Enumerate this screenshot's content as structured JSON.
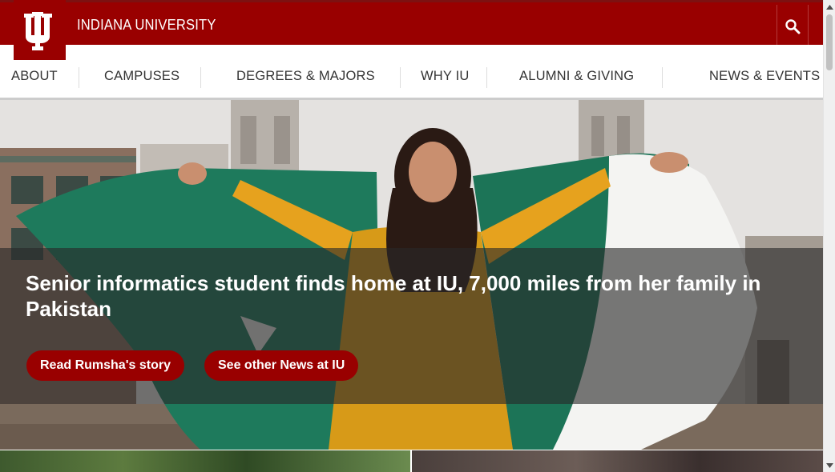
{
  "header": {
    "logo_alt": "IU",
    "title": "INDIANA UNIVERSITY",
    "search_icon": "search-icon",
    "brand_color": "#990000"
  },
  "nav": {
    "items": [
      "ABOUT",
      "CAMPUSES",
      "DEGREES & MAJORS",
      "WHY IU",
      "ALUMNI & GIVING",
      "NEWS & EVENTS"
    ]
  },
  "hero": {
    "headline": "Senior informatics student finds home at IU, 7,000 miles from her family in Pakistan",
    "buttons": [
      "Read Rumsha's story",
      "See other News at IU"
    ]
  }
}
